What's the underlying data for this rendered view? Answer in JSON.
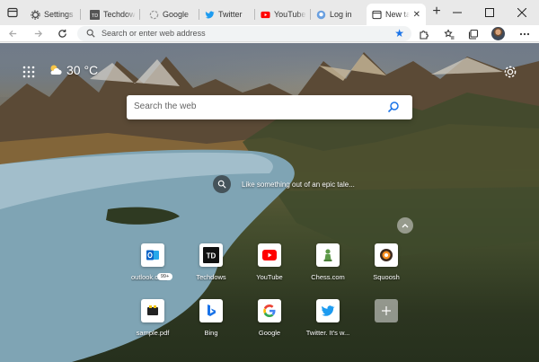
{
  "tabs": [
    {
      "title": "Settings",
      "favicon": "gear-icon"
    },
    {
      "title": "Techdows",
      "favicon": "td-icon"
    },
    {
      "title": "Google",
      "favicon": "google-icon"
    },
    {
      "title": "Twitter",
      "favicon": "twitter-icon"
    },
    {
      "title": "YouTube",
      "favicon": "youtube-icon"
    },
    {
      "title": "Log in",
      "favicon": "github-icon"
    },
    {
      "title": "New tab",
      "favicon": "newtab-icon",
      "active": true
    }
  ],
  "toolbar": {
    "address_placeholder": "Search or enter web address"
  },
  "newtab": {
    "weather_temp": "30 °C",
    "search_placeholder": "Search the web",
    "image_caption": "Like something out of an epic tale...",
    "quick_links": [
      {
        "label": "outlook.com",
        "icon": "outlook-icon",
        "badge": "99+"
      },
      {
        "label": "Techdows",
        "icon": "td-icon"
      },
      {
        "label": "YouTube",
        "icon": "youtube-icon"
      },
      {
        "label": "Chess.com",
        "icon": "chess-icon"
      },
      {
        "label": "Squoosh",
        "icon": "squoosh-icon"
      },
      {
        "label": "sample.pdf",
        "icon": "pdf-icon"
      },
      {
        "label": "Bing",
        "icon": "bing-icon"
      },
      {
        "label": "Google",
        "icon": "google-icon"
      },
      {
        "label": "Twitter. It's w...",
        "icon": "twitter-icon"
      },
      {
        "label": "",
        "icon": "add-icon"
      }
    ]
  },
  "colors": {
    "accent": "#1a73e8",
    "youtube_red": "#ff0000",
    "twitter_blue": "#1d9bf0",
    "outlook_blue": "#0a64c8"
  }
}
